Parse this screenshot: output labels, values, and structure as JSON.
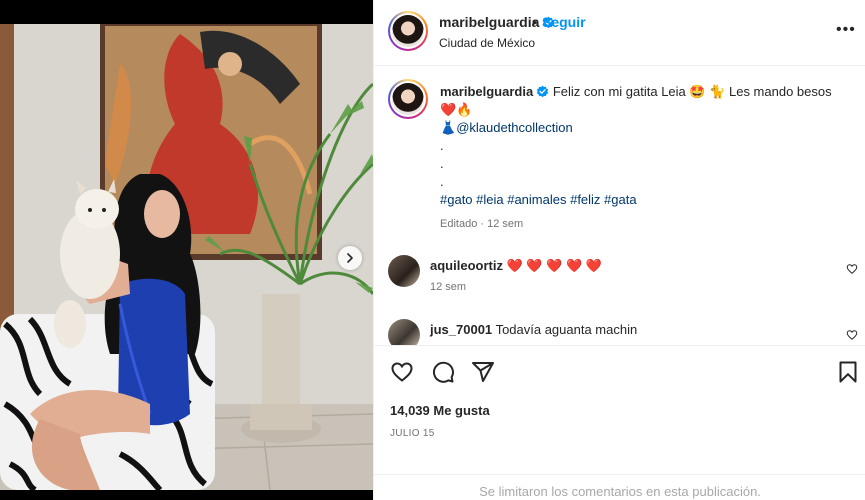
{
  "post": {
    "author": "maribelguardia",
    "separator": "•",
    "follow_label": "Seguir",
    "location": "Ciudad de México",
    "more_label": "•••"
  },
  "caption": {
    "user": "maribelguardia",
    "text_1": "Feliz con mi gatita Leia 🤩 🐈 Les mando besos ❤️🔥",
    "dress_emoji": "👗",
    "mention": "@klaudethcollection",
    "dots": [
      ".",
      ".",
      "."
    ],
    "hashtags": "#gato #leia #animales #feliz #gata",
    "meta": "Editado · 12 sem"
  },
  "comments": [
    {
      "user": "aquileoortiz",
      "text": "❤️ ❤️ ❤️ ❤️ ❤️",
      "meta": "12 sem"
    },
    {
      "user": "jus_70001",
      "text": "Todavía aguanta machin",
      "meta": ""
    }
  ],
  "stats": {
    "likes": "14,039 Me gusta",
    "date": "JULIO 15"
  },
  "footer": {
    "comments_limited": "Se limitaron los comentarios en esta publicación."
  },
  "icons": {
    "verified": "verified-badge-icon",
    "like": "heart-outline-icon",
    "comment": "comment-bubble-icon",
    "share": "paper-plane-icon",
    "save": "bookmark-icon",
    "next": "chevron-right-icon"
  },
  "colors": {
    "link": "#00376b",
    "follow": "#0095f6",
    "verified": "#0095f6",
    "muted": "#737373"
  }
}
